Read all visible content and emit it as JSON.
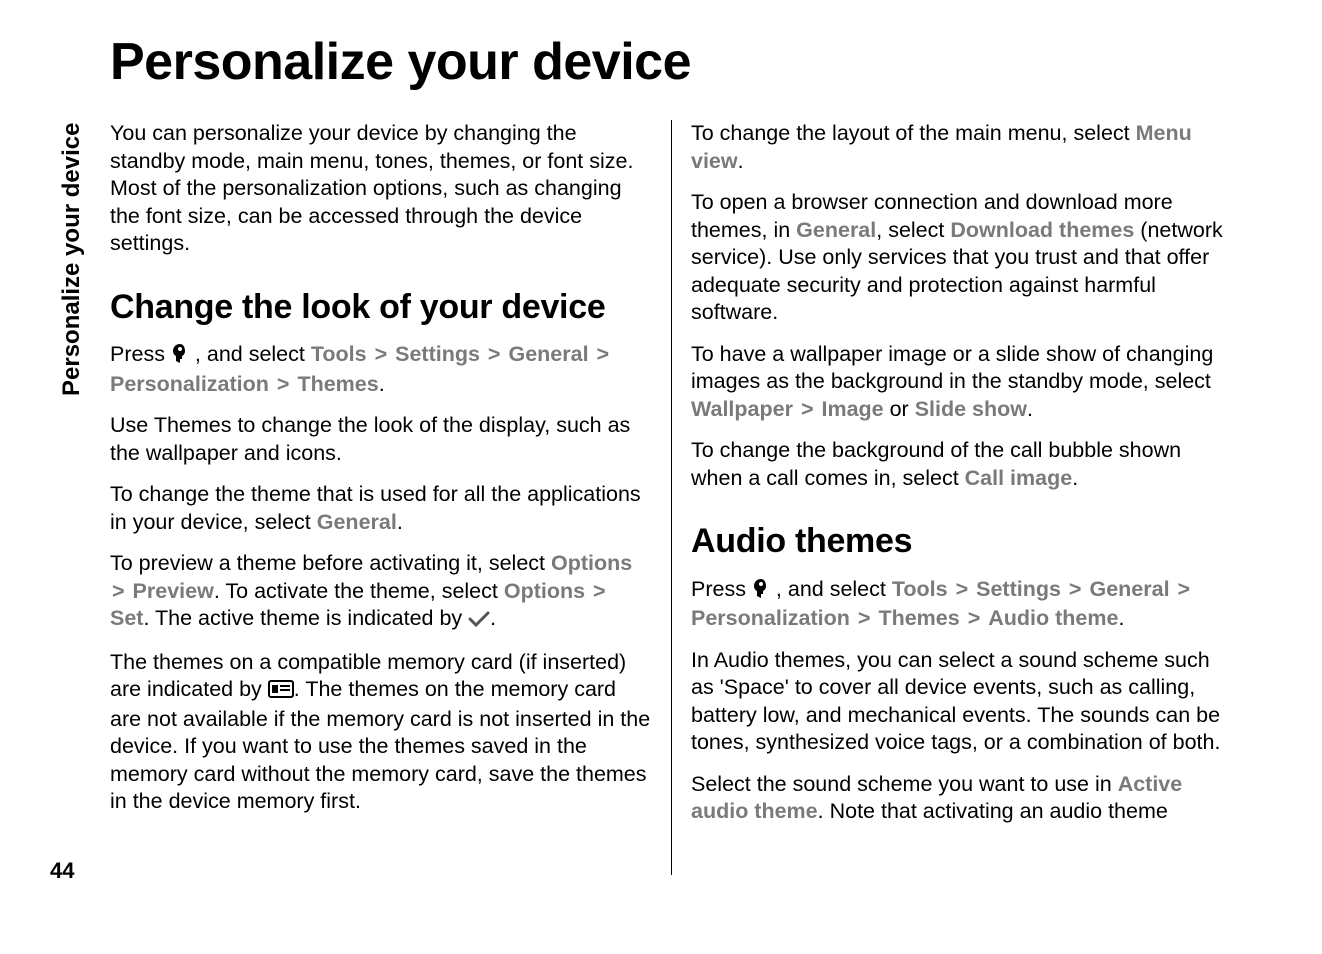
{
  "side_tab": "Personalize your device",
  "page_number": "44",
  "title": "Personalize your device",
  "intro": "You can personalize your device by changing the standby mode, main menu, tones, themes, or font size. Most of the personalization options, such as changing the font size, can be accessed through the device settings.",
  "section1": {
    "heading": "Change the look of your device",
    "p1_a": "Press ",
    "p1_b": " , and select ",
    "nav": {
      "tools": "Tools",
      "settings": "Settings",
      "general": "General",
      "personalization": "Personalization",
      "themes": "Themes"
    },
    "p2": "Use Themes to change the look of the display, such as the wallpaper and icons.",
    "p3_a": "To change the theme that is used for all the applications in your device, select ",
    "p3_general": "General",
    "p4_a": "To preview a theme before activating it, select ",
    "p4_options1": "Options",
    "p4_preview": "Preview",
    "p4_b": ". To activate the theme, select ",
    "p4_options2": "Options",
    "p4_set": "Set",
    "p4_c": ". The active theme is indicated by ",
    "p5_a": "The themes on a compatible memory card (if inserted) are indicated by ",
    "p5_b": ". The themes on the memory card are not available if the memory card is not inserted in the device. If you want to use the themes saved in the memory card without the memory card, save the themes in the device memory first.",
    "p6_a": "To change the layout of the main menu, select ",
    "p6_menu_view": "Menu view",
    "p7_a": "To open a browser connection and download more themes, in ",
    "p7_general": "General",
    "p7_b": ", select ",
    "p7_download_themes": "Download themes",
    "p7_c": " (network service). Use only services that you trust and that offer adequate security and protection against harmful software.",
    "p8_a": "To have a wallpaper image or a slide show of changing images as the background in the standby mode, select ",
    "p8_wallpaper": "Wallpaper",
    "p8_image": "Image",
    "p8_or": " or ",
    "p8_slide": "Slide show",
    "p9_a": "To change the background of the call bubble shown when a call comes in, select ",
    "p9_call_image": "Call image"
  },
  "section2": {
    "heading": "Audio themes",
    "p1_a": "Press ",
    "p1_b": " , and select ",
    "nav": {
      "tools": "Tools",
      "settings": "Settings",
      "general": "General",
      "personalization": "Personalization",
      "themes": "Themes",
      "audio_theme": "Audio theme"
    },
    "p2": "In Audio themes, you can select a sound scheme such as 'Space' to cover all device events, such as calling, battery low, and mechanical events. The sounds can be tones, synthesized voice tags, or a combination of both.",
    "p3_a": "Select the sound scheme you want to use in ",
    "p3_active": "Active audio theme",
    "p3_b": ". Note that activating an audio theme"
  },
  "glyphs": {
    "gt": ">",
    "period": "."
  }
}
